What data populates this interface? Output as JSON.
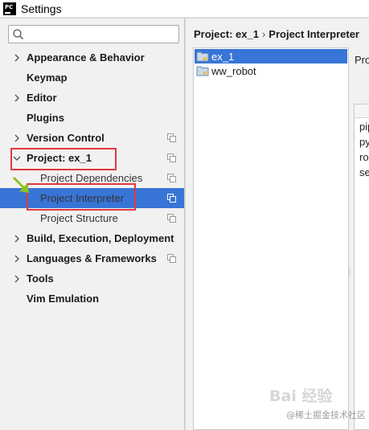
{
  "window": {
    "app_icon_text": "PC",
    "title": "Settings"
  },
  "search": {
    "value": "",
    "placeholder": ""
  },
  "tree": [
    {
      "label": "Appearance & Behavior",
      "bold": true,
      "arrow": "right"
    },
    {
      "label": "Keymap",
      "bold": true,
      "arrow": ""
    },
    {
      "label": "Editor",
      "bold": true,
      "arrow": "right"
    },
    {
      "label": "Plugins",
      "bold": true,
      "arrow": ""
    },
    {
      "label": "Version Control",
      "bold": true,
      "arrow": "right",
      "copy_icon": true
    },
    {
      "label": "Project: ex_1",
      "bold": true,
      "arrow": "down",
      "copy_icon": true
    },
    {
      "label": "Project Dependencies",
      "bold": false,
      "arrow": "",
      "copy_icon": true
    },
    {
      "label": "Project Interpreter",
      "bold": false,
      "arrow": "",
      "copy_icon": true,
      "selected": true
    },
    {
      "label": "Project Structure",
      "bold": false,
      "arrow": "",
      "copy_icon": true
    },
    {
      "label": "Build, Execution, Deployment",
      "bold": true,
      "arrow": "right"
    },
    {
      "label": "Languages & Frameworks",
      "bold": true,
      "arrow": "right",
      "copy_icon": true
    },
    {
      "label": "Tools",
      "bold": true,
      "arrow": "right"
    },
    {
      "label": "Vim Emulation",
      "bold": true,
      "arrow": ""
    }
  ],
  "breadcrumb": {
    "part1": "Project: ex_1",
    "separator": "›",
    "part2": "Project Interpreter"
  },
  "projects": [
    {
      "label": "ex_1",
      "selected": true
    },
    {
      "label": "ww_robot",
      "selected": false
    }
  ],
  "detail": {
    "label": "Pro",
    "packages": [
      "pip",
      "py",
      "ro",
      "se"
    ]
  },
  "watermark": {
    "line1": "Bai 经验",
    "line2": "@稀土掘金技术社区"
  },
  "colors": {
    "selection": "#3875d6",
    "highlight_box": "#e0393e",
    "arrow_annotation": "#8dc21f"
  }
}
